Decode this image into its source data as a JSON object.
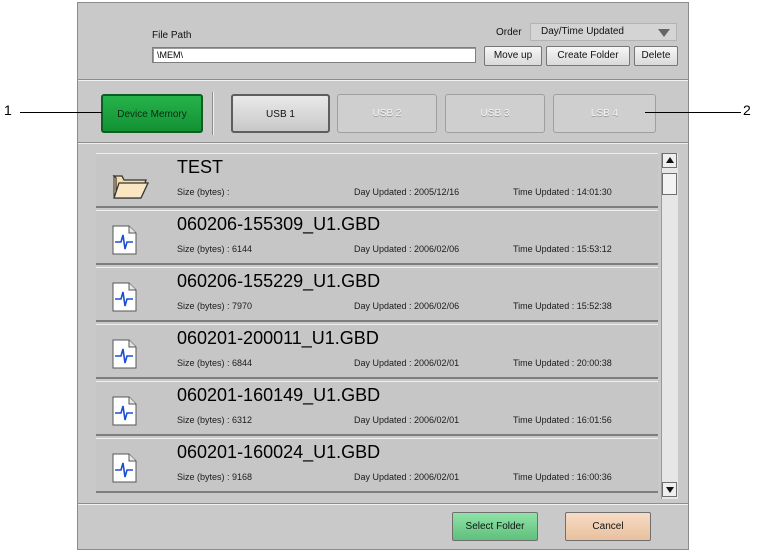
{
  "header": {
    "file_path_label": "File Path",
    "file_path_value": "\\MEM\\",
    "order_label": "Order",
    "order_value": "Day/Time Updated",
    "buttons": {
      "move_up": "Move up",
      "create_folder": "Create Folder",
      "delete": "Delete"
    }
  },
  "media": [
    {
      "label": "Device Memory",
      "state": "active"
    },
    {
      "label": "USB 1",
      "state": "normal"
    },
    {
      "label": "USB 2",
      "state": "disabled"
    },
    {
      "label": "USB 3",
      "state": "disabled"
    },
    {
      "label": "LSB 4",
      "state": "disabled"
    }
  ],
  "files": [
    {
      "type": "folder",
      "name": "TEST",
      "size": "Size (bytes) :",
      "day": "Day Updated : 2005/12/16",
      "time": "Time Updated : 14:01:30"
    },
    {
      "type": "file",
      "name": "060206-155309_U1.GBD",
      "size": "Size (bytes) : 6144",
      "day": "Day Updated : 2006/02/06",
      "time": "Time Updated : 15:53:12"
    },
    {
      "type": "file",
      "name": "060206-155229_U1.GBD",
      "size": "Size (bytes) : 7970",
      "day": "Day Updated : 2006/02/06",
      "time": "Time Updated : 15:52:38"
    },
    {
      "type": "file",
      "name": "060201-200011_U1.GBD",
      "size": "Size (bytes) : 6844",
      "day": "Day Updated : 2006/02/01",
      "time": "Time Updated : 20:00:38"
    },
    {
      "type": "file",
      "name": "060201-160149_U1.GBD",
      "size": "Size (bytes) : 6312",
      "day": "Day Updated : 2006/02/01",
      "time": "Time Updated : 16:01:56"
    },
    {
      "type": "file",
      "name": "060201-160024_U1.GBD",
      "size": "Size (bytes) : 9168",
      "day": "Day Updated : 2006/02/01",
      "time": "Time Updated : 16:00:36"
    }
  ],
  "footer": {
    "select_folder": "Select Folder",
    "cancel": "Cancel"
  },
  "callouts": [
    "1",
    "2"
  ],
  "colors": {
    "active_media": "#1ca33f",
    "panel": "#c9c9c9",
    "select_button": "#79d394",
    "cancel_button": "#f0cfb1"
  }
}
